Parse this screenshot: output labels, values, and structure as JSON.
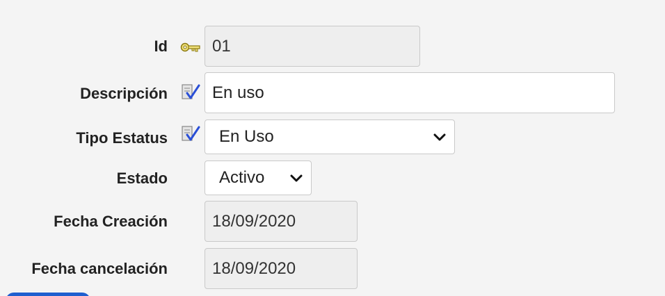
{
  "fields": {
    "id": {
      "label": "Id",
      "value": "01",
      "icon": "key-icon"
    },
    "descripcion": {
      "label": "Descripción",
      "value": "En uso",
      "icon": "edit-check-icon"
    },
    "tipo_estatus": {
      "label": "Tipo Estatus",
      "value": "En Uso",
      "icon": "edit-check-icon"
    },
    "estado": {
      "label": "Estado",
      "value": "Activo"
    },
    "fecha_creacion": {
      "label": "Fecha Creación",
      "value": "18/09/2020"
    },
    "fecha_cancelacion": {
      "label": "Fecha cancelación",
      "value": "18/09/2020"
    }
  },
  "colors": {
    "background": "#f4f4f4",
    "readonly_field": "#eeeeee",
    "border": "#c9c9c9",
    "key_icon": "#d9c430",
    "check_icon": "#2a4fd6"
  }
}
